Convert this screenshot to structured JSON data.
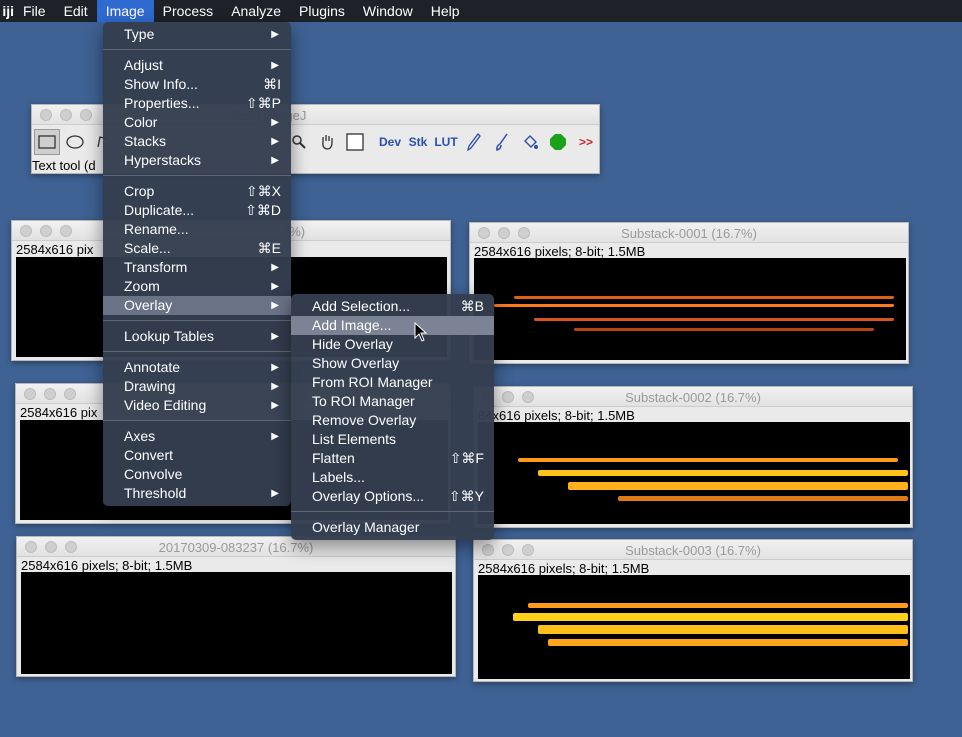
{
  "menubar": {
    "app": "iji",
    "items": [
      "File",
      "Edit",
      "Image",
      "Process",
      "Analyze",
      "Plugins",
      "Window",
      "Help"
    ],
    "active": "Image"
  },
  "toolbar_window": {
    "title": "Just) ImageJ",
    "status": "Text tool (d",
    "buttons": [
      "Dev",
      "Stk",
      "LUT",
      ">>"
    ]
  },
  "image_windows": [
    {
      "title": "7%)",
      "info": "2584x616 pix"
    },
    {
      "title": "",
      "info": "2584x616 pix"
    },
    {
      "title": "20170309-083237 (16.7%)",
      "info": "2584x616 pixels; 8-bit; 1.5MB"
    },
    {
      "title": "Substack-0001 (16.7%)",
      "info": "2584x616 pixels; 8-bit; 1.5MB"
    },
    {
      "title": "Substack-0002 (16.7%)",
      "info": "84x616 pixels; 8-bit; 1.5MB"
    },
    {
      "title": "Substack-0003 (16.7%)",
      "info": "2584x616 pixels; 8-bit; 1.5MB"
    }
  ],
  "image_menu": {
    "groups": [
      [
        {
          "label": "Type",
          "submenu": true
        }
      ],
      [
        {
          "label": "Adjust",
          "submenu": true
        },
        {
          "label": "Show Info...",
          "shortcut": "⌘I"
        },
        {
          "label": "Properties...",
          "shortcut": "⇧⌘P"
        },
        {
          "label": "Color",
          "submenu": true
        },
        {
          "label": "Stacks",
          "submenu": true
        },
        {
          "label": "Hyperstacks",
          "submenu": true
        }
      ],
      [
        {
          "label": "Crop",
          "shortcut": "⇧⌘X"
        },
        {
          "label": "Duplicate...",
          "shortcut": "⇧⌘D"
        },
        {
          "label": "Rename..."
        },
        {
          "label": "Scale...",
          "shortcut": "⌘E"
        },
        {
          "label": "Transform",
          "submenu": true
        },
        {
          "label": "Zoom",
          "submenu": true
        },
        {
          "label": "Overlay",
          "submenu": true,
          "highlighted": true
        }
      ],
      [
        {
          "label": "Lookup Tables",
          "submenu": true
        }
      ],
      [
        {
          "label": "Annotate",
          "submenu": true
        },
        {
          "label": "Drawing",
          "submenu": true
        },
        {
          "label": "Video Editing",
          "submenu": true
        }
      ],
      [
        {
          "label": "Axes",
          "submenu": true
        },
        {
          "label": "Convert"
        },
        {
          "label": "Convolve"
        },
        {
          "label": "Threshold",
          "submenu": true
        }
      ]
    ]
  },
  "overlay_menu": {
    "groups": [
      [
        {
          "label": "Add Selection...",
          "shortcut": "⌘B"
        },
        {
          "label": "Add Image...",
          "highlighted": true
        },
        {
          "label": "Hide Overlay"
        },
        {
          "label": "Show Overlay"
        },
        {
          "label": "From ROI Manager"
        },
        {
          "label": "To ROI Manager"
        },
        {
          "label": "Remove Overlay"
        },
        {
          "label": "List Elements"
        },
        {
          "label": "Flatten",
          "shortcut": "⇧⌘F"
        },
        {
          "label": "Labels..."
        },
        {
          "label": "Overlay Options...",
          "shortcut": "⇧⌘Y"
        }
      ],
      [
        {
          "label": "Overlay Manager"
        }
      ]
    ]
  },
  "colors": {
    "desktop": "#3f6294",
    "menu_bg": "#343e50",
    "menu_highlight": "#6a7386",
    "menubar_active": "#2f6ad1",
    "heat_orange": "#ff8c1a",
    "heat_yellow": "#ffd21a"
  }
}
